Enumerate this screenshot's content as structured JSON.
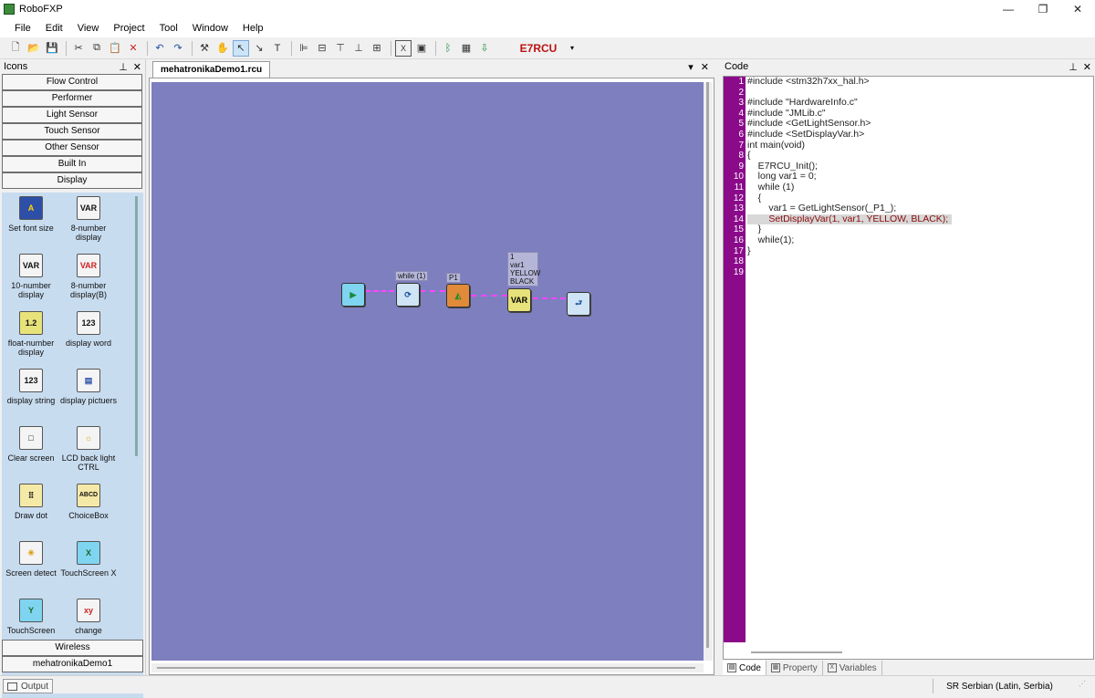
{
  "window": {
    "title": "RoboFXP",
    "minimize": "—",
    "restore": "❐",
    "close": "✕"
  },
  "menu": [
    "File",
    "Edit",
    "View",
    "Project",
    "Tool",
    "Window",
    "Help"
  ],
  "toolbar": {
    "target": "E7RCU",
    "dropdown_arrow": "▾",
    "buttons": [
      {
        "name": "new-file-icon",
        "glyph": "🗋"
      },
      {
        "name": "open-folder-icon",
        "glyph": "📂"
      },
      {
        "name": "save-icon",
        "glyph": "💾"
      },
      {
        "name": "cut-icon",
        "glyph": "✂"
      },
      {
        "name": "copy-icon",
        "glyph": "⧉"
      },
      {
        "name": "paste-icon",
        "glyph": "📋"
      },
      {
        "name": "delete-icon",
        "glyph": "✕"
      },
      {
        "name": "undo-icon",
        "glyph": "↶"
      },
      {
        "name": "redo-icon",
        "glyph": "↷"
      },
      {
        "name": "tools-icon",
        "glyph": "⚒"
      },
      {
        "name": "hand-icon",
        "glyph": "✋"
      },
      {
        "name": "pointer-icon",
        "glyph": "↖"
      },
      {
        "name": "connect-icon",
        "glyph": "↘"
      },
      {
        "name": "text-icon",
        "glyph": "T"
      },
      {
        "name": "align-left-icon",
        "glyph": "⊫"
      },
      {
        "name": "align-center-icon",
        "glyph": "⊟"
      },
      {
        "name": "align-top-icon",
        "glyph": "⊤"
      },
      {
        "name": "align-bottom-icon",
        "glyph": "⊥"
      },
      {
        "name": "grid-icon",
        "glyph": "⊞"
      },
      {
        "name": "variable-icon",
        "glyph": "X"
      },
      {
        "name": "image-icon",
        "glyph": "▣"
      },
      {
        "name": "bluetooth-icon",
        "glyph": "ᛒ"
      },
      {
        "name": "chip-icon",
        "glyph": "▦"
      },
      {
        "name": "download-icon",
        "glyph": "⇩"
      }
    ]
  },
  "icons_panel": {
    "title": "Icons",
    "pin": "⊥",
    "close": "✕",
    "categories": [
      "Flow Control",
      "Performer",
      "Light Sensor",
      "Touch Sensor",
      "Other Sensor",
      "Built In",
      "Display"
    ],
    "bottom_categories": [
      "Wireless",
      "mehatronikaDemo1"
    ],
    "items": [
      {
        "label": "Set font size",
        "glyph": "A"
      },
      {
        "label": "8-number display",
        "glyph": "VAR"
      },
      {
        "label": "10-number display",
        "glyph": "VAR"
      },
      {
        "label": "8-number display(B)",
        "glyph": "VAR"
      },
      {
        "label": "float-number display",
        "glyph": "1.2"
      },
      {
        "label": "display word",
        "glyph": "123"
      },
      {
        "label": "display string",
        "glyph": "123"
      },
      {
        "label": "display pictuers",
        "glyph": "▤"
      },
      {
        "label": "Clear screen",
        "glyph": "□"
      },
      {
        "label": "LCD back light CTRL",
        "glyph": "☼"
      },
      {
        "label": "Draw dot",
        "glyph": "⠿"
      },
      {
        "label": "ChoiceBox",
        "glyph": "ABCD"
      },
      {
        "label": "Screen detect",
        "glyph": "✳"
      },
      {
        "label": "TouchScreen X",
        "glyph": "X"
      },
      {
        "label": "TouchScreen",
        "glyph": "Y"
      },
      {
        "label": "change",
        "glyph": "xy"
      }
    ]
  },
  "editor": {
    "tab": "mehatronikaDemo1.rcu",
    "menu_arrow": "▾",
    "close": "✕",
    "nodes": {
      "start_glyph": "▶",
      "while_glyph": "⟳",
      "while_label": "while (1)",
      "sensor_glyph": "◭",
      "sensor_label": "P1",
      "display_glyph": "VAR",
      "display_label_lines": [
        "1",
        "var1",
        "YELLOW",
        "BLACK"
      ],
      "loop_end_glyph": "⮐"
    }
  },
  "code_panel": {
    "title": "Code",
    "pin": "⊥",
    "close": "✕",
    "lines": [
      "#include <stm32h7xx_hal.h>",
      "",
      "#include \"HardwareInfo.c\"",
      "#include \"JMLib.c\"",
      "#include <GetLightSensor.h>",
      "#include <SetDisplayVar.h>",
      "int main(void)",
      "{",
      "    E7RCU_Init();",
      "    long var1 = 0;",
      "    while (1)",
      "    {",
      "        var1 = GetLightSensor(_P1_);",
      "        SetDisplayVar(1, var1, YELLOW, BLACK);",
      "    }",
      "    while(1);",
      "}",
      "",
      ""
    ],
    "tabs": [
      "Code",
      "Property",
      "Variables"
    ]
  },
  "statusbar": {
    "output": "Output",
    "language": "SR Serbian (Latin, Serbia)"
  }
}
